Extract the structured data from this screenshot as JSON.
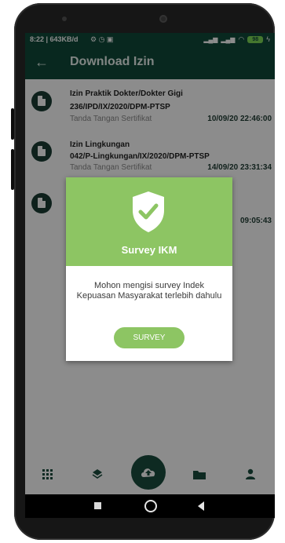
{
  "status_bar": {
    "time": "8:22 | 643KB/d",
    "battery": "98"
  },
  "app_bar": {
    "title": "Download Izin",
    "back_icon": "arrow-left-icon"
  },
  "list": [
    {
      "title": "Izin Praktik Dokter/Dokter Gigi",
      "number": "236/IPD/IX/2020/DPM-PTSP",
      "subtitle": "Tanda Tangan Sertifikat",
      "date": "10/09/20 22:46:00"
    },
    {
      "title": "Izin Lingkungan",
      "number": "042/P-Lingkungan/IX/2020/DPM-PTSP",
      "subtitle": "Tanda Tangan Sertifikat",
      "date": "14/09/20 23:31:34"
    },
    {
      "date": "09:05:43"
    }
  ],
  "dialog": {
    "title": "Survey IKM",
    "message": "Mohon mengisi survey Indek Kepuasan Masyarakat terlebih dahulu",
    "button": "SURVEY",
    "icon": "shield-check-icon"
  },
  "bottom_nav": {
    "items": [
      "grid-icon",
      "layers-icon",
      "cloud-upload-icon",
      "folder-icon",
      "person-icon"
    ]
  },
  "system_nav": [
    "recents-icon",
    "home-icon",
    "back-icon"
  ],
  "colors": {
    "primary": "#0f4a3a",
    "accent": "#8dc563"
  }
}
